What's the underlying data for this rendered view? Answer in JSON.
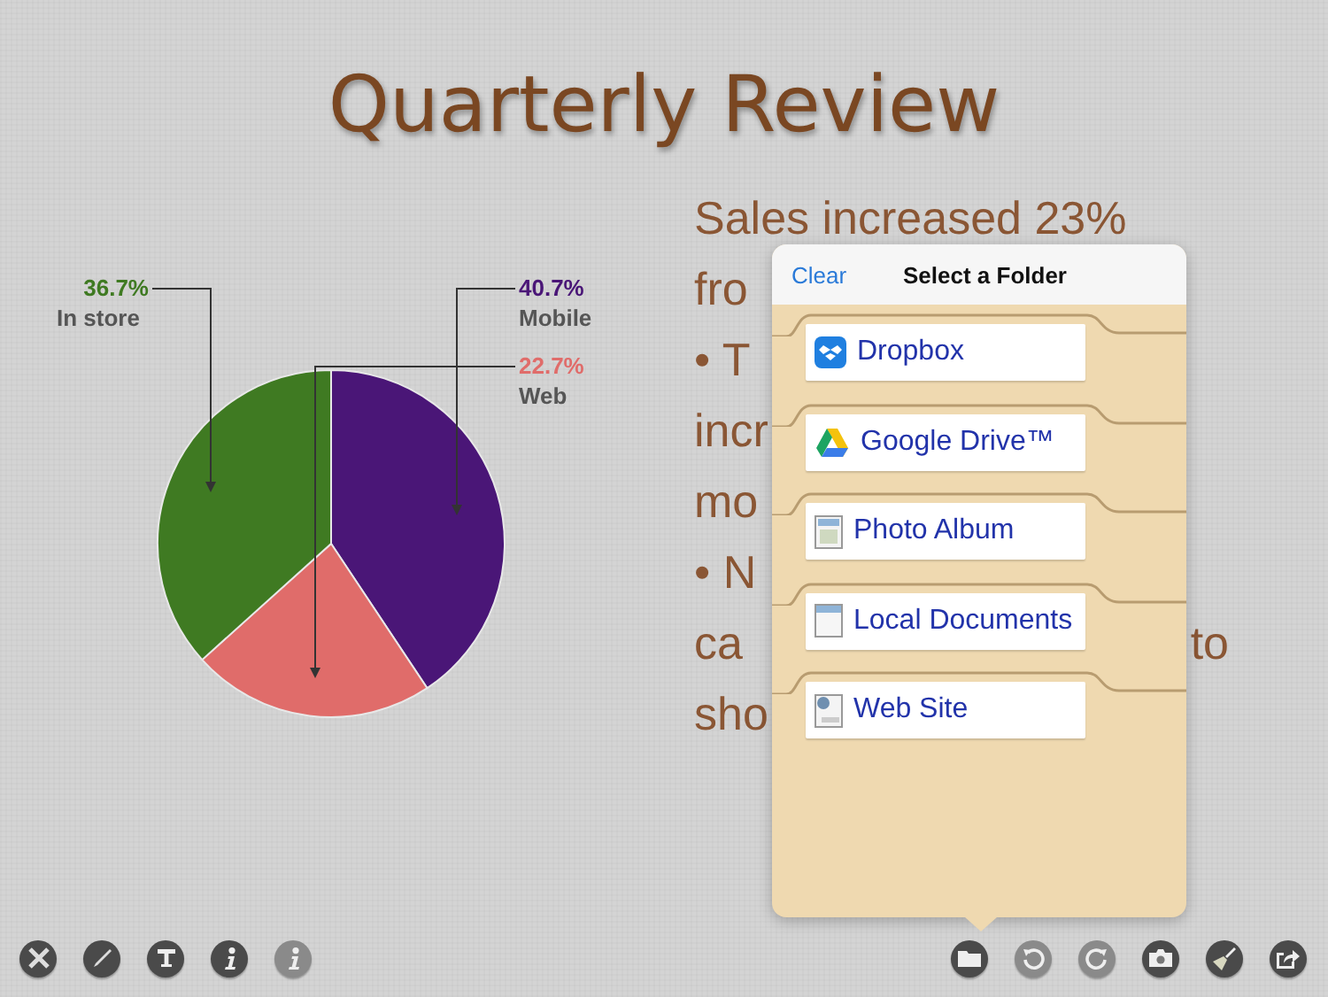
{
  "slide": {
    "title": "Quarterly Review",
    "chart": {
      "chart_data": {
        "type": "pie",
        "categories": [
          "Mobile",
          "Web",
          "In store"
        ],
        "values": [
          40.7,
          22.7,
          36.7
        ],
        "colors": [
          "#4a1677",
          "#e06c6a",
          "#3f7a22"
        ],
        "data_labels": true,
        "value_labels": [
          "40.7%",
          "22.7%",
          "36.7%"
        ]
      }
    },
    "body_lines": [
      [
        "Sales increased 23%"
      ],
      [
        "fro"
      ],
      [
        "• T"
      ],
      [
        "incr"
      ],
      [
        "mo"
      ],
      [
        "• N"
      ],
      [
        "ca",
        "to"
      ],
      [
        "sho"
      ]
    ]
  },
  "popover": {
    "clear": "Clear",
    "title": "Select a Folder",
    "folders": [
      {
        "label": "Dropbox",
        "kind": "dropbox"
      },
      {
        "label": "Google Drive™",
        "kind": "drive"
      },
      {
        "label": "Photo Album",
        "kind": "photos"
      },
      {
        "label": "Local Documents",
        "kind": "documents"
      },
      {
        "label": "Web Site",
        "kind": "web"
      }
    ]
  },
  "toolbar": {
    "left": [
      {
        "kind": "tools",
        "disabled": false
      },
      {
        "kind": "pen",
        "disabled": false
      },
      {
        "kind": "text",
        "disabled": false
      },
      {
        "kind": "info",
        "disabled": false
      },
      {
        "kind": "info",
        "disabled": true
      }
    ],
    "right": [
      {
        "kind": "folder",
        "disabled": false
      },
      {
        "kind": "undo",
        "disabled": true
      },
      {
        "kind": "redo",
        "disabled": true
      },
      {
        "kind": "camera",
        "disabled": false
      },
      {
        "kind": "brush",
        "disabled": false
      },
      {
        "kind": "share",
        "disabled": false
      }
    ]
  }
}
